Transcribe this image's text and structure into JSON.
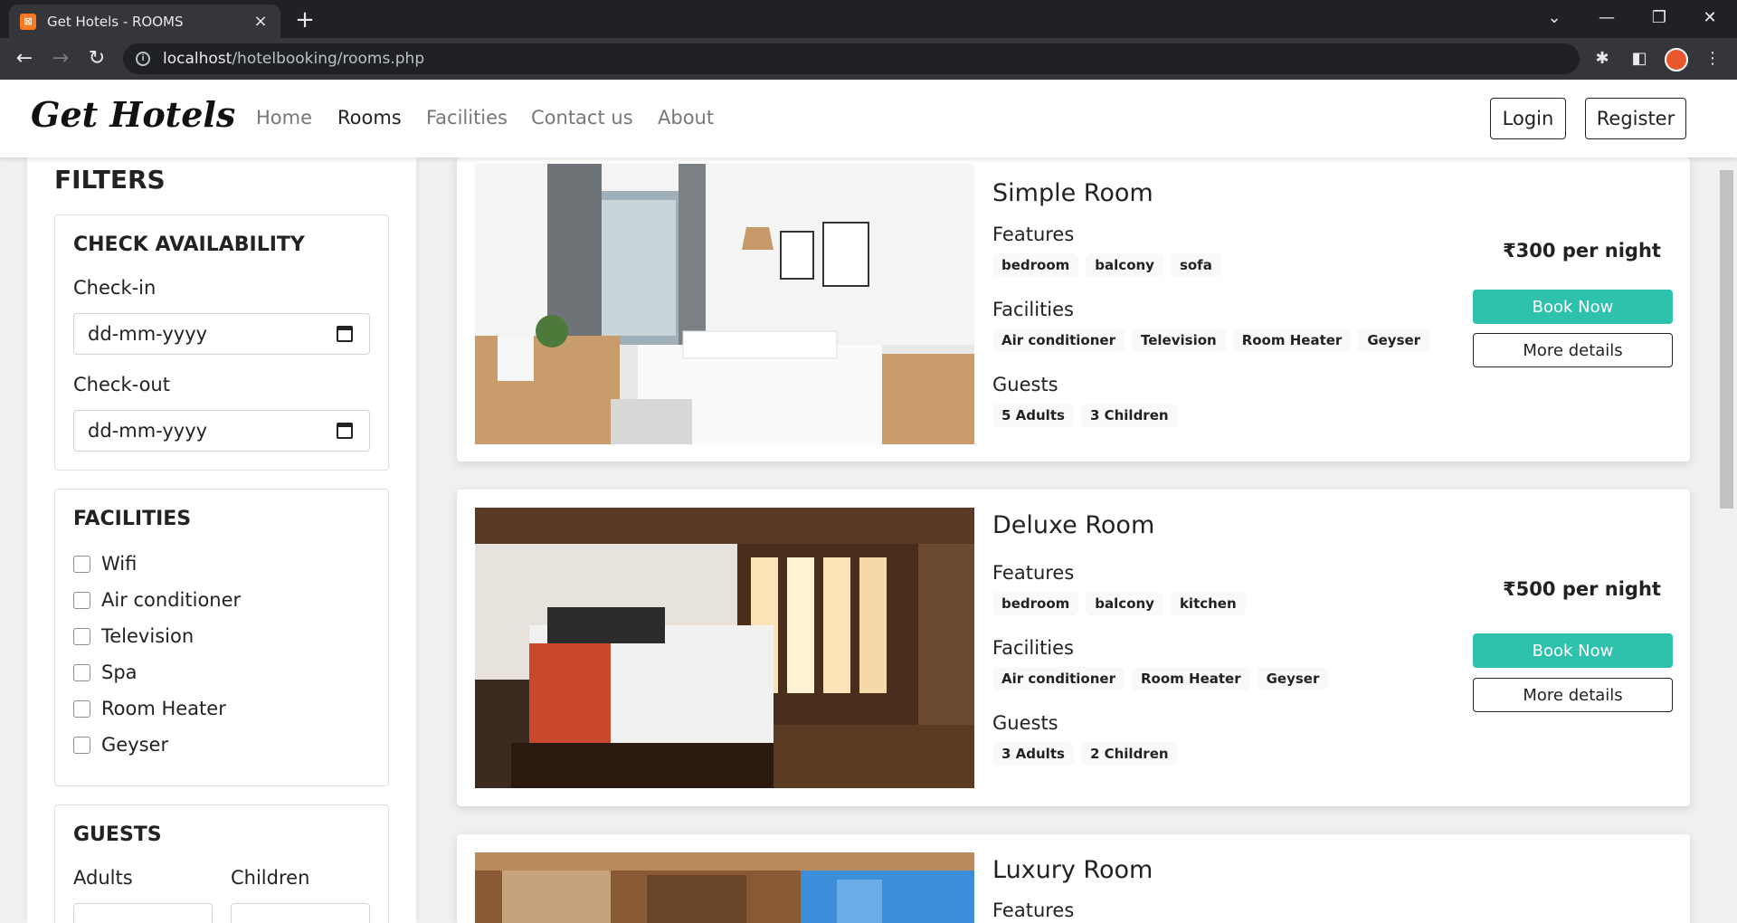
{
  "browser": {
    "tab_title": "Get Hotels - ROOMS",
    "tab_favicon_text": "⊠",
    "url_host": "localhost",
    "url_path": "/hotelbooking/rooms.php"
  },
  "navbar": {
    "brand": "Get Hotels",
    "links": [
      "Home",
      "Rooms",
      "Facilities",
      "Contact us",
      "About"
    ],
    "active_link": "Rooms",
    "login": "Login",
    "register": "Register"
  },
  "filters": {
    "title": "FILTERS",
    "availability": {
      "title": "CHECK AVAILABILITY",
      "checkin_label": "Check-in",
      "checkin_value": "dd-mm-yyyy",
      "checkout_label": "Check-out",
      "checkout_value": "dd-mm-yyyy"
    },
    "facilities": {
      "title": "FACILITIES",
      "items": [
        "Wifi",
        "Air conditioner",
        "Television",
        "Spa",
        "Room Heater",
        "Geyser"
      ]
    },
    "guests": {
      "title": "GUESTS",
      "adults_label": "Adults",
      "children_label": "Children"
    }
  },
  "rooms": [
    {
      "name": "Simple Room",
      "features_label": "Features",
      "features": [
        "bedroom",
        "balcony",
        "sofa"
      ],
      "facilities_label": "Facilities",
      "facilities": [
        "Air conditioner",
        "Television",
        "Room Heater",
        "Geyser"
      ],
      "guests_label": "Guests",
      "guests": [
        "5 Adults",
        "3 Children"
      ],
      "price": "₹300 per night",
      "book": "Book Now",
      "details": "More details"
    },
    {
      "name": "Deluxe Room",
      "features_label": "Features",
      "features": [
        "bedroom",
        "balcony",
        "kitchen"
      ],
      "facilities_label": "Facilities",
      "facilities": [
        "Air conditioner",
        "Room Heater",
        "Geyser"
      ],
      "guests_label": "Guests",
      "guests": [
        "3 Adults",
        "2 Children"
      ],
      "price": "₹500 per night",
      "book": "Book Now",
      "details": "More details"
    },
    {
      "name": "Luxury Room",
      "features_label": "Features"
    }
  ],
  "colors": {
    "accent": "#2ec1ac",
    "chrome_dark": "#202124",
    "chrome_mid": "#35363a"
  }
}
